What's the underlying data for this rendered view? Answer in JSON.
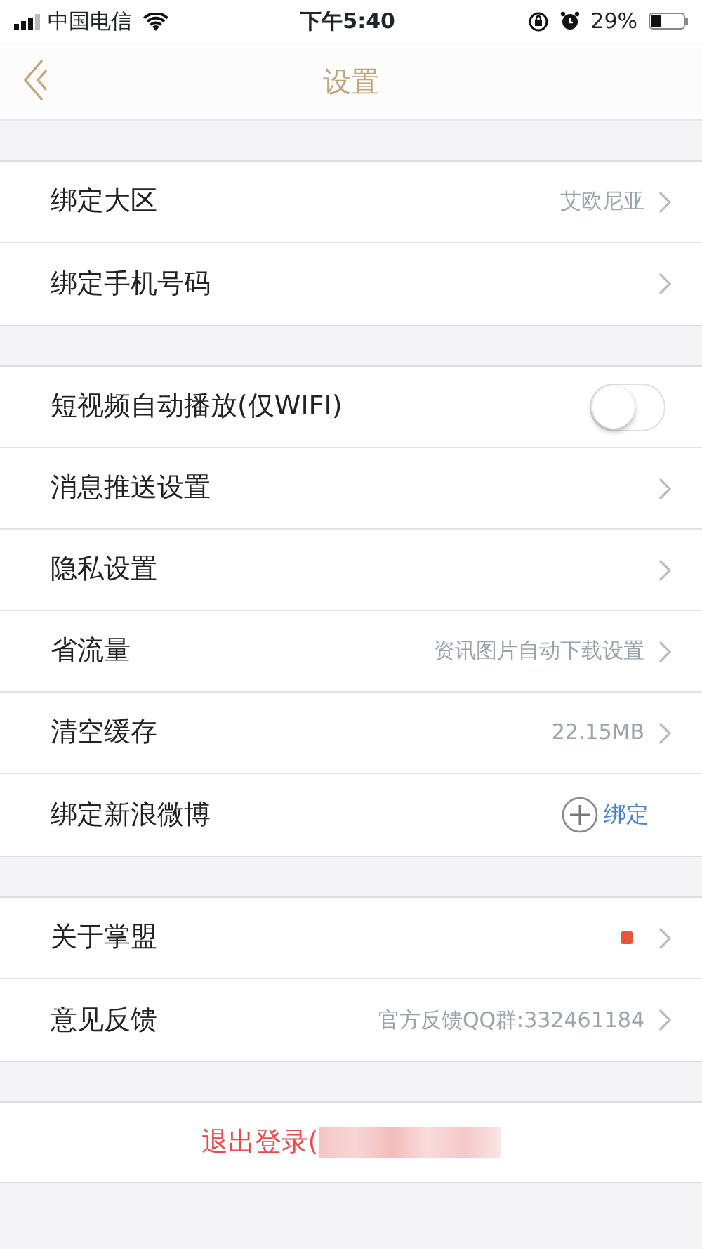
{
  "status_bar": {
    "carrier": "中国电信",
    "time": "下午5:40",
    "battery": "29%"
  },
  "nav": {
    "title": "设置"
  },
  "groups": [
    {
      "rows": [
        {
          "kind": "link",
          "label": "绑定大区",
          "value": "艾欧尼亚"
        },
        {
          "kind": "link",
          "label": "绑定手机号码"
        }
      ]
    },
    {
      "rows": [
        {
          "kind": "toggle",
          "label": "短视频自动播放(仅WIFI)",
          "on": false
        },
        {
          "kind": "link",
          "label": "消息推送设置"
        },
        {
          "kind": "link",
          "label": "隐私设置"
        },
        {
          "kind": "link",
          "label": "省流量",
          "value": "资讯图片自动下载设置"
        },
        {
          "kind": "link",
          "label": "清空缓存",
          "value": "22.15MB"
        },
        {
          "kind": "bind",
          "label": "绑定新浪微博",
          "value": "绑定"
        }
      ]
    },
    {
      "rows": [
        {
          "kind": "dot",
          "label": "关于掌盟",
          "color": "#e8553e"
        },
        {
          "kind": "link",
          "label": "意见反馈",
          "value": "官方反馈QQ群:332461184"
        }
      ]
    }
  ],
  "logout": {
    "label": "退出登录("
  }
}
